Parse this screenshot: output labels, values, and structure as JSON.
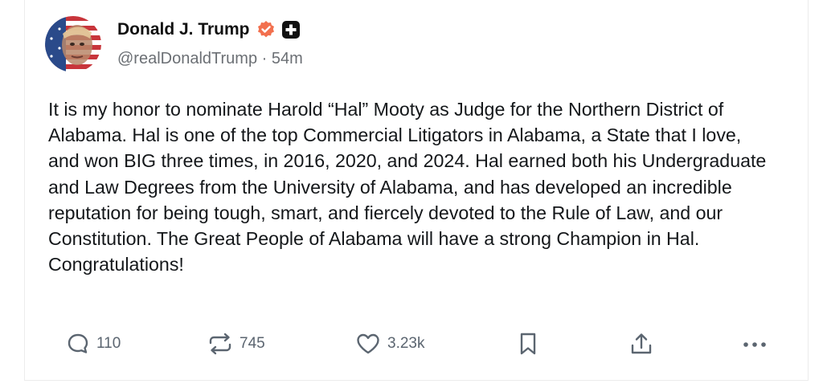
{
  "post": {
    "author_name": "Donald J. Trump",
    "handle": "@realDonaldTrump",
    "separator": "·",
    "time_ago": "54m",
    "text": "It is my honor to nominate Harold “Hal” Mooty as Judge for the Northern District of Alabama. Hal is one of the top Commercial Litigators in Alabama, a State that I love, and won BIG three times, in 2016, 2020, and 2024. Hal earned both his Undergraduate and Law Degrees from the University of Alabama, and has developed an incredible reputation for being tough, smart, and fiercely devoted to the Rule of Law, and our Constitution. The Great People of Alabama will have a strong Champion in Hal. Congratulations!"
  },
  "actions": {
    "replies": {
      "icon": "reply-icon",
      "count": "110"
    },
    "reposts": {
      "icon": "repost-icon",
      "count": "745"
    },
    "likes": {
      "icon": "heart-icon",
      "count": "3.23k"
    },
    "bookmark": {
      "icon": "bookmark-icon"
    },
    "share": {
      "icon": "share-icon"
    },
    "more": {
      "icon": "more-icon"
    }
  },
  "colors": {
    "verified_badge": "#f2704e",
    "text": "#14171a",
    "muted": "#6b6f74",
    "icon": "#5b6570"
  }
}
